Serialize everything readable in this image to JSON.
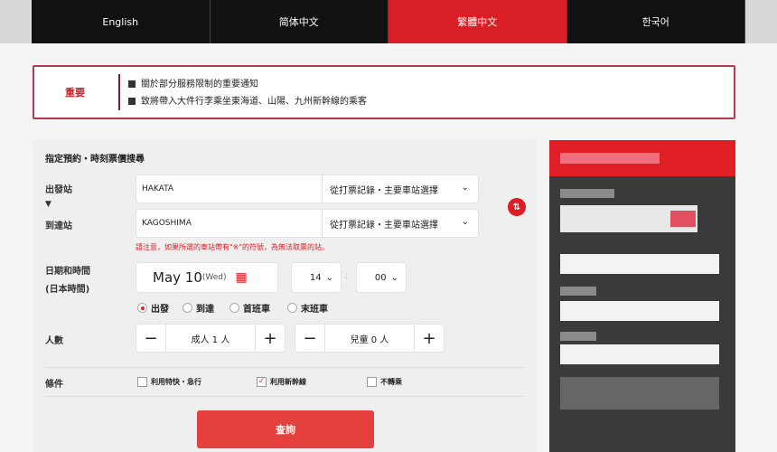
{
  "languages": [
    {
      "label": "English"
    },
    {
      "label": "简体中文"
    },
    {
      "label": "繁體中文",
      "active": true
    },
    {
      "label": "한국어"
    }
  ],
  "notice": {
    "label": "重要",
    "items": [
      "關於部分服務限制的重要通知",
      "致將帶入大件行李乘坐東海道、山陽、九州新幹線的乘客"
    ]
  },
  "form": {
    "title": "指定預約・時刻票價搜尋",
    "departure_label": "出發站",
    "arrow": "▼",
    "arrival_label": "到達站",
    "departure_value": "HAKATA",
    "arrival_value": "KAGOSHIMA",
    "station_select": "從打票記錄・主要車站選擇",
    "note": "請注意，如果所選的車站帶有\"※\"的符號，為無法取票的站。",
    "datetime_label": "日期和時間",
    "timezone_label": "(日本時間)",
    "date": "May 10",
    "weekday": "(Wed)",
    "hour": "14",
    "minute": "00",
    "time_sep": ":",
    "radios": [
      {
        "label": "出發",
        "checked": true
      },
      {
        "label": "到達"
      },
      {
        "label": "首班車"
      },
      {
        "label": "末班車"
      }
    ],
    "people_label": "人數",
    "minus": "−",
    "plus": "+",
    "adults": "成人 1 人",
    "children": "兒童 0 人",
    "conditions_label": "條件",
    "conditions": [
      {
        "label": "利用特快・急行",
        "checked": false
      },
      {
        "label": "利用新幹線",
        "checked": true
      },
      {
        "label": "不轉乘",
        "checked": false
      }
    ],
    "search_button": "查詢"
  },
  "colors": {
    "accent": "#d91e26",
    "button": "#e4403d"
  }
}
